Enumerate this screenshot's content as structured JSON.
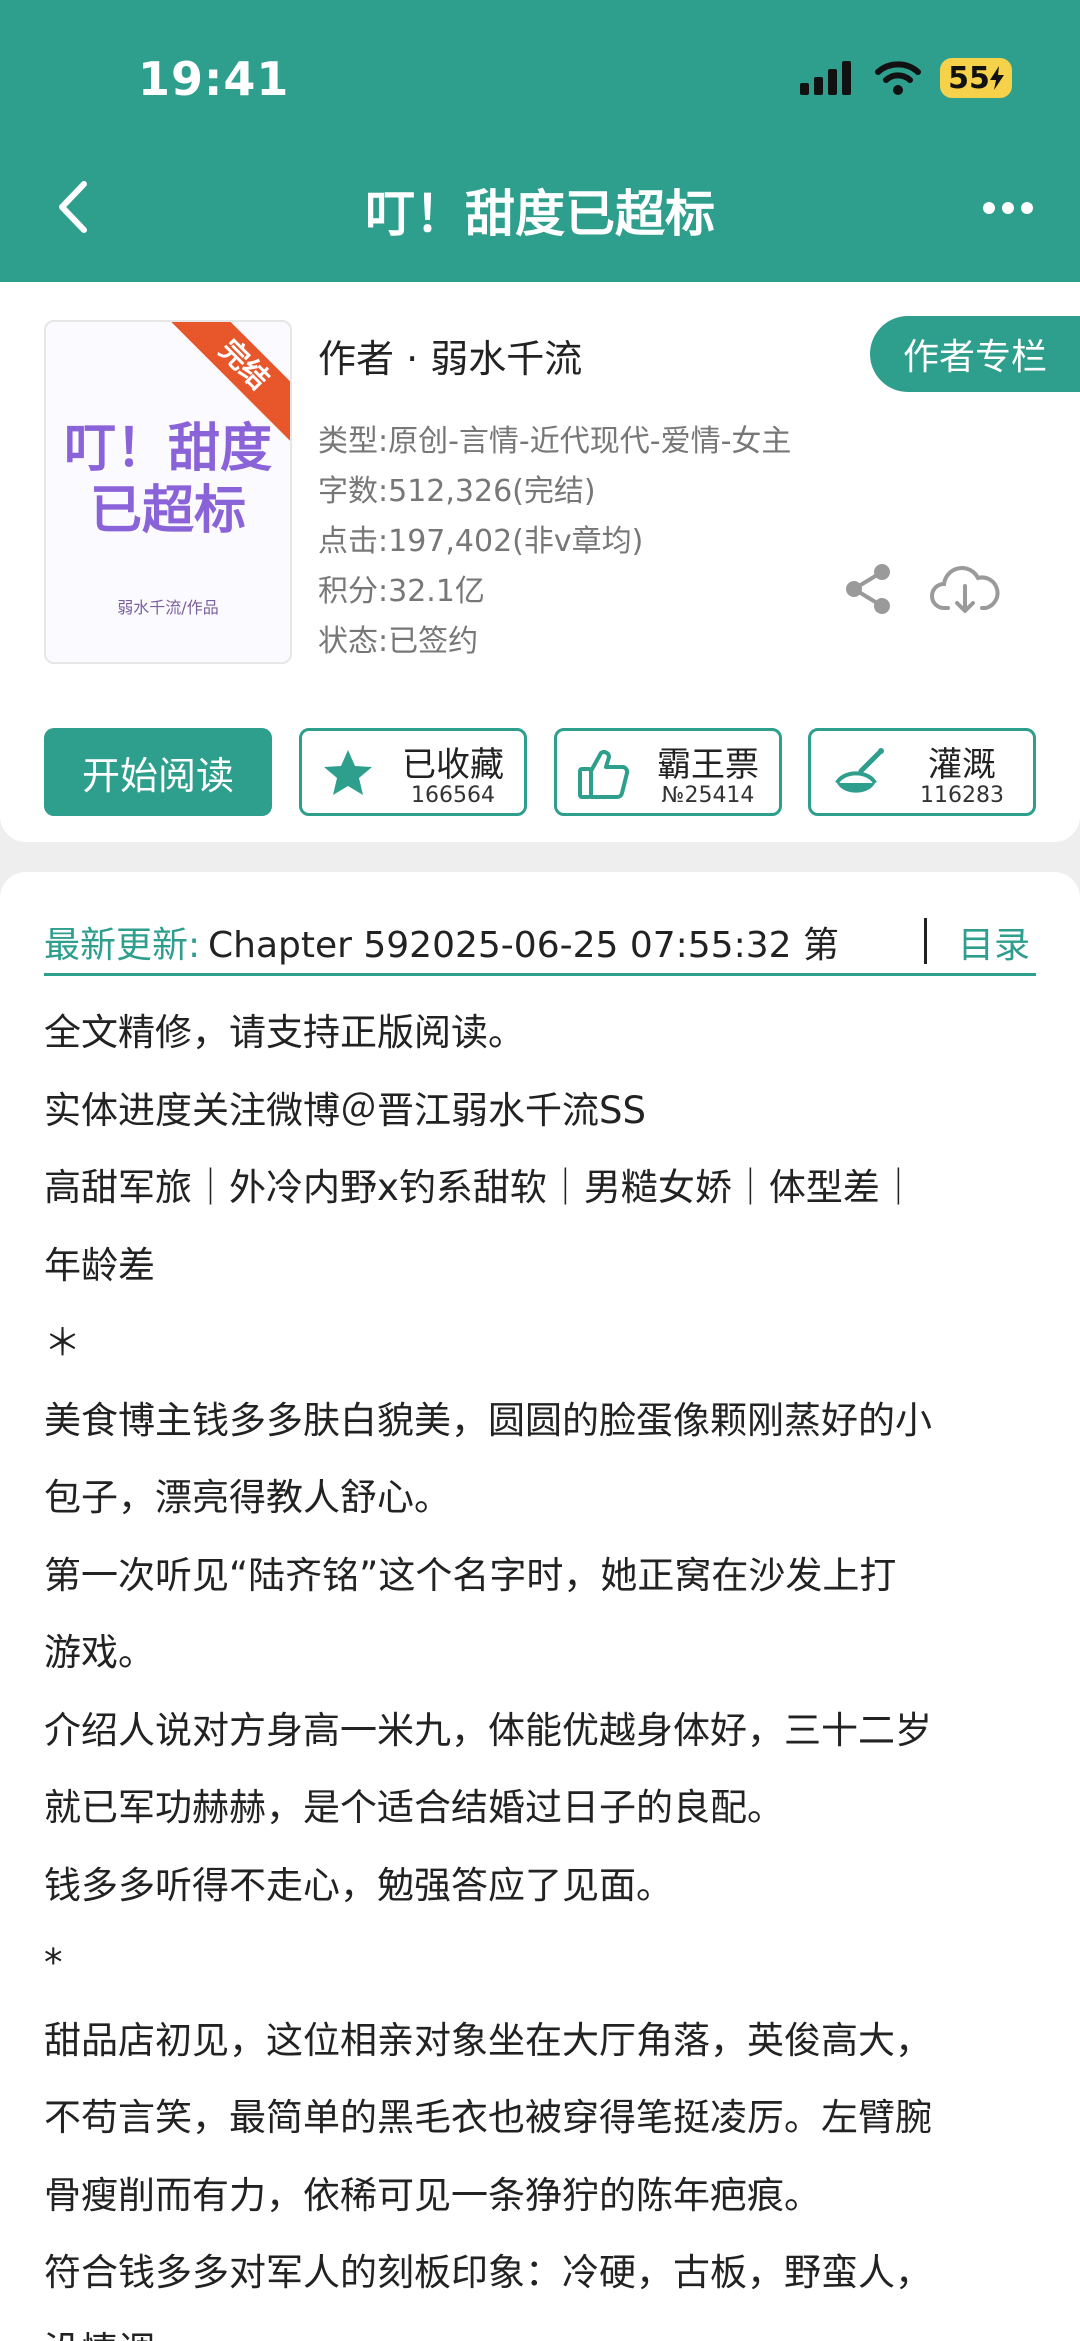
{
  "status_bar": {
    "time": "19:41",
    "battery": "55"
  },
  "nav": {
    "title": "叮！甜度已超标",
    "back_icon": "chevron-left-icon",
    "more_icon": "more-dots-icon"
  },
  "book": {
    "cover": {
      "badge": "完结",
      "title_line1": "叮！甜度",
      "title_line2": "已超标",
      "author": "弱水千流/作品"
    },
    "author_line": "作者 · 弱水千流",
    "author_column_button": "作者专栏",
    "meta": [
      "类型:原创-言情-近代现代-爱情-女主",
      "字数:512,326(完结)",
      "点击:197,402(非v章均)",
      "积分:32.1亿",
      "状态:已签约"
    ]
  },
  "actions": {
    "read": "开始阅读",
    "favorite": {
      "label": "已收藏",
      "count": "166564",
      "icon": "star-icon"
    },
    "vote": {
      "label": "霸王票",
      "count": "№25414",
      "icon": "thumbs-up-icon"
    },
    "water": {
      "label": "灌溉",
      "count": "116283",
      "icon": "watering-flask-icon"
    }
  },
  "update": {
    "label": "最新更新:",
    "text": "Chapter 592025-06-25 07:55:32  第",
    "toc": "目录"
  },
  "description": [
    "全文精修，请支持正版阅读。",
    "实体进度关注微博＠晋江弱水千流SS",
    "高甜军旅｜外冷内野x钓系甜软｜男糙女娇｜体型差｜",
    "年龄差",
    "＊",
    "美食博主钱多多肤白貌美，圆圆的脸蛋像颗刚蒸好的小",
    "包子，漂亮得教人舒心。",
    "第一次听见“陆齐铭”这个名字时，她正窝在沙发上打",
    "游戏。",
    "介绍人说对方身高一米九，体能优越身体好，三十二岁",
    "就已军功赫赫，是个适合结婚过日子的良配。",
    "钱多多听得不走心，勉强答应了见面。",
    "*",
    "甜品店初见，这位相亲对象坐在大厅角落，英俊高大，",
    "不苟言笑，最简单的黑毛衣也被穿得笔挺凌厉。左臂腕",
    "骨瘦削而有力，依稀可见一条狰狞的陈年疤痕。",
    "符合钱多多对军人的刻板印象：冷硬，古板，野蛮人，",
    "没情调。"
  ],
  "colors": {
    "brand": "#2e9e8d",
    "ribbon": "#e7572b"
  }
}
